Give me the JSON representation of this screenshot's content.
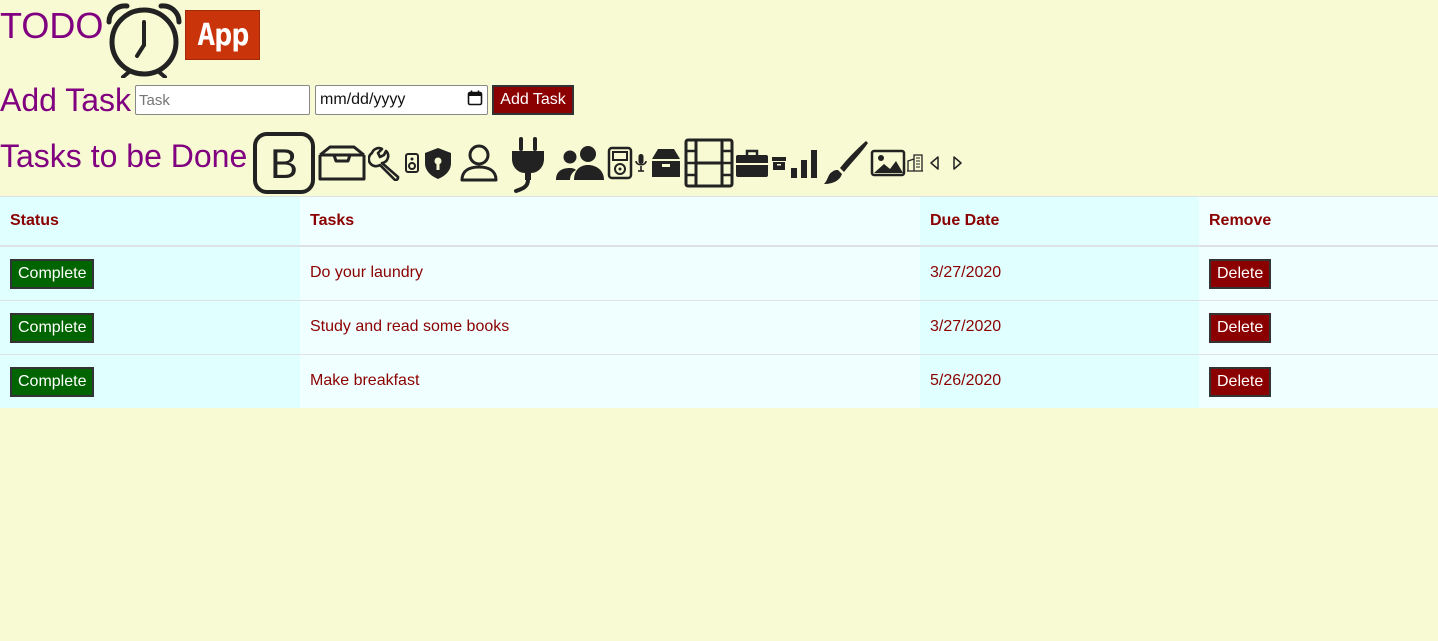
{
  "header": {
    "title": "TODO",
    "logo_text": "App"
  },
  "add_task": {
    "heading": "Add Task",
    "task_placeholder": "Task",
    "date_placeholder": "mm/dd/yyyy",
    "button_label": "Add Task"
  },
  "task_list": {
    "heading": "Tasks to be Done",
    "icons": [
      "bootstrap-b-icon",
      "inbox-icon",
      "wrench-icon",
      "speaker-icon",
      "shield-lock-icon",
      "person-icon",
      "plug-icon",
      "people-icon",
      "music-player-icon",
      "mic-icon",
      "archive-icon",
      "film-icon",
      "briefcase-icon",
      "archive-small-icon",
      "bar-chart-icon",
      "brush-icon",
      "image-icon",
      "building-icon",
      "caret-left-icon",
      "caret-right-icon"
    ]
  },
  "table": {
    "columns": [
      "Status",
      "Tasks",
      "Due Date",
      "Remove"
    ],
    "rows": [
      {
        "status_label": "Complete",
        "task": "Do your laundry",
        "due": "3/27/2020",
        "remove_label": "Delete"
      },
      {
        "status_label": "Complete",
        "task": "Study and read some books",
        "due": "3/27/2020",
        "remove_label": "Delete"
      },
      {
        "status_label": "Complete",
        "task": "Make breakfast",
        "due": "5/26/2020",
        "remove_label": "Delete"
      }
    ]
  },
  "colors": {
    "background": "#f7fad2",
    "heading": "#800080",
    "text_accent": "#8b0000",
    "complete_button": "#006400",
    "delete_button": "#8b0000"
  }
}
